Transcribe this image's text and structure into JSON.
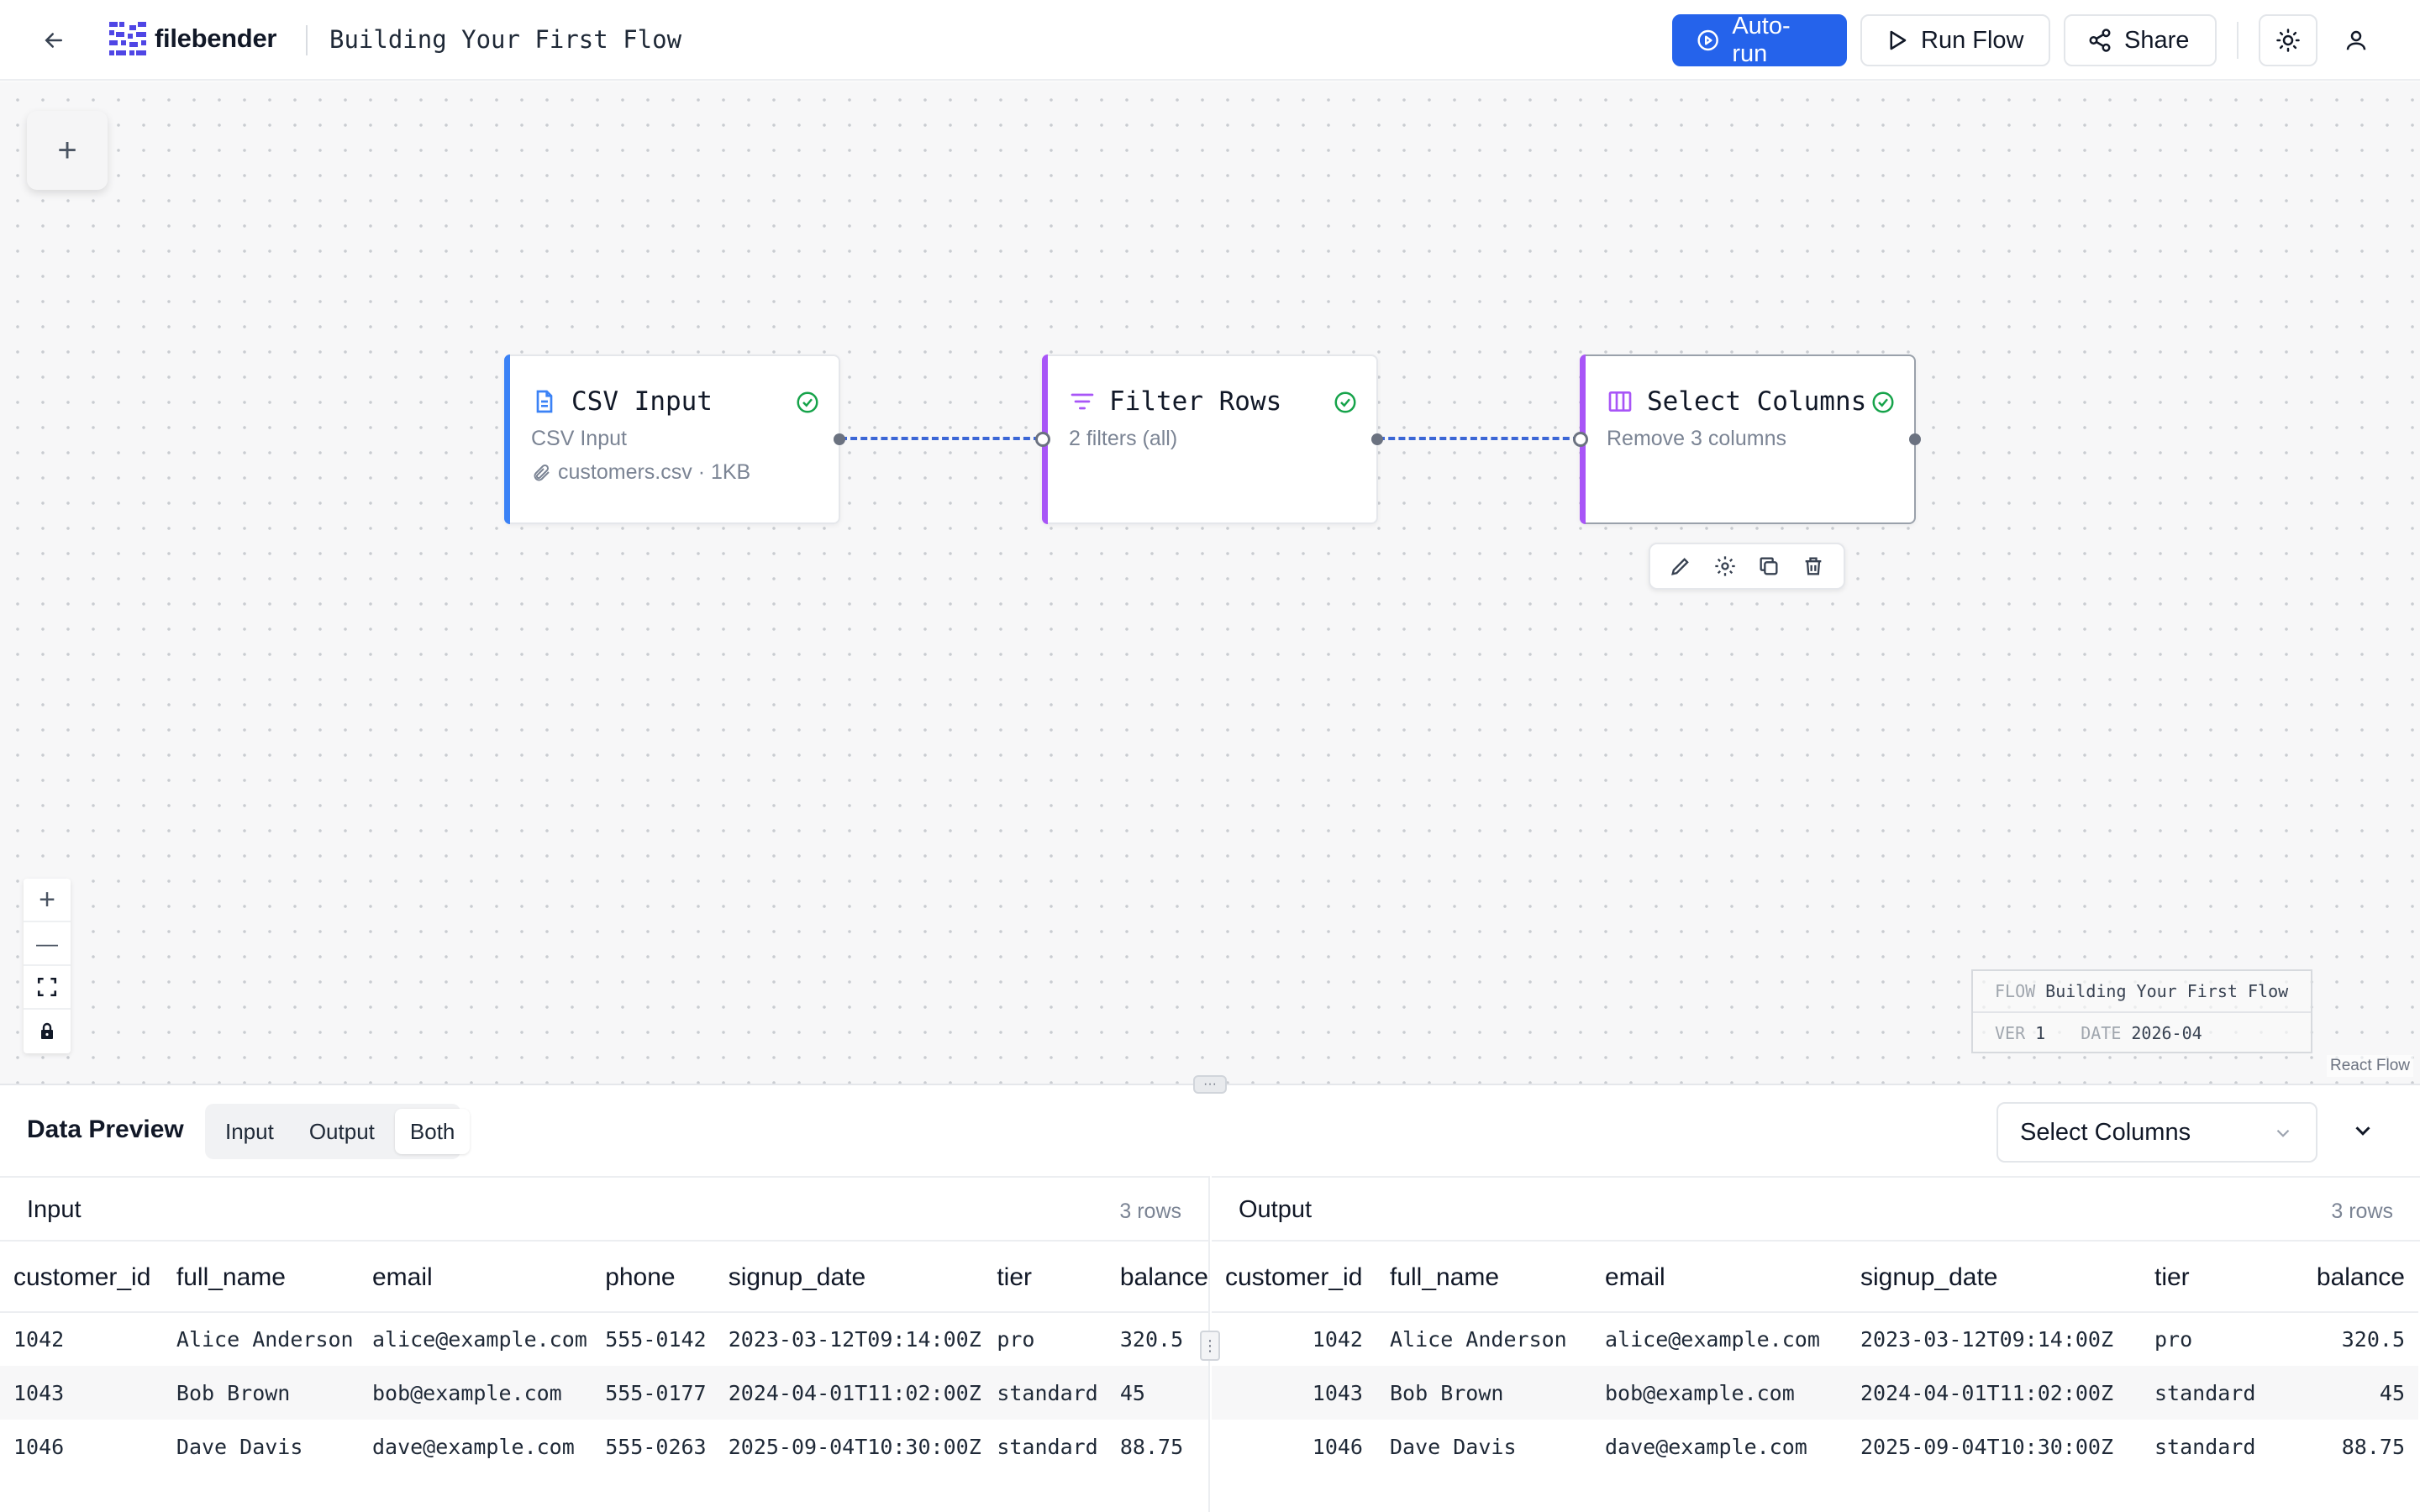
{
  "header": {
    "logo_text": "filebender",
    "flow_title": "Building Your First Flow",
    "autorun_label": "Auto-run",
    "run_flow_label": "Run Flow",
    "share_label": "Share"
  },
  "colors": {
    "primary": "#2563eb",
    "csv_accent": "#3b82f6",
    "transform_accent": "#a855f7",
    "success": "#16a34a",
    "edge": "#3b66d6"
  },
  "canvas": {
    "add_node_label": "+",
    "nodes": [
      {
        "title": "CSV Input",
        "subtitle": "CSV Input",
        "file": "customers.csv · 1KB",
        "icon": "file-text-icon",
        "status": "check-circle-icon"
      },
      {
        "title": "Filter Rows",
        "subtitle": "2 filters (all)",
        "icon": "filter-icon",
        "status": "check-circle-icon"
      },
      {
        "title": "Select Columns",
        "subtitle": "Remove 3 columns",
        "icon": "columns-icon",
        "status": "check-circle-icon",
        "selected": true
      }
    ],
    "node_toolbar": [
      "pencil-icon",
      "gear-icon",
      "copy-icon",
      "trash-icon"
    ],
    "zoom_controls": {
      "zoom_in": "+",
      "zoom_out": "—"
    },
    "flow_info": {
      "flow_key": "FLOW",
      "flow_value": "Building Your First Flow",
      "ver_key": "VER",
      "ver_value": "1",
      "date_key": "DATE",
      "date_value": "2026-04"
    },
    "attribution": "React Flow"
  },
  "panel": {
    "title": "Data Preview",
    "tabs": [
      "Input",
      "Output",
      "Both"
    ],
    "active_tab": "Both",
    "selected_node": "Select Columns",
    "input": {
      "label": "Input",
      "count": "3 rows",
      "columns": [
        "customer_id",
        "full_name",
        "email",
        "phone",
        "signup_date",
        "tier",
        "balance"
      ],
      "rows": [
        [
          "1042",
          "Alice Anderson",
          "alice@example.com",
          "555-0142",
          "2023-03-12T09:14:00Z",
          "pro",
          "320.5"
        ],
        [
          "1043",
          "Bob Brown",
          "bob@example.com",
          "555-0177",
          "2024-04-01T11:02:00Z",
          "standard",
          "45"
        ],
        [
          "1046",
          "Dave Davis",
          "dave@example.com",
          "555-0263",
          "2025-09-04T10:30:00Z",
          "standard",
          "88.75"
        ]
      ]
    },
    "output": {
      "label": "Output",
      "count": "3 rows",
      "columns": [
        "customer_id",
        "full_name",
        "email",
        "signup_date",
        "tier",
        "balance"
      ],
      "rows": [
        [
          "1042",
          "Alice Anderson",
          "alice@example.com",
          "2023-03-12T09:14:00Z",
          "pro",
          "320.5"
        ],
        [
          "1043",
          "Bob Brown",
          "bob@example.com",
          "2024-04-01T11:02:00Z",
          "standard",
          "45"
        ],
        [
          "1046",
          "Dave Davis",
          "dave@example.com",
          "2025-09-04T10:30:00Z",
          "standard",
          "88.75"
        ]
      ]
    }
  }
}
